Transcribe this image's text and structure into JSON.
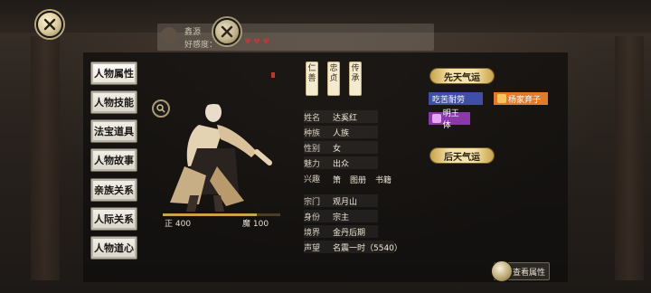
{
  "nav": [
    {
      "label": "人物属性",
      "active": true
    },
    {
      "label": "人物技能",
      "active": false
    },
    {
      "label": "法宝道具",
      "active": false
    },
    {
      "label": "人物故事",
      "active": false
    },
    {
      "label": "亲族关系",
      "active": false
    },
    {
      "label": "人际关系",
      "active": false
    },
    {
      "label": "人物道心",
      "active": false
    }
  ],
  "top_panel": {
    "name": "鑫源",
    "sub": "好感度："
  },
  "character": {
    "alignment_left": "正 400",
    "alignment_right": "魔 100",
    "alignment_fraction": 0.8
  },
  "virtues": [
    "仁善",
    "忠贞",
    "传承"
  ],
  "info": [
    {
      "label": "姓名",
      "value": "达奚红"
    },
    {
      "label": "种族",
      "value": "人族"
    },
    {
      "label": "性别",
      "value": "女"
    },
    {
      "label": "魅力",
      "value": "出众"
    }
  ],
  "hobbies": {
    "label": "兴趣",
    "items": [
      "箫",
      "图册",
      "书籍"
    ]
  },
  "info2": [
    {
      "label": "宗门",
      "value": "观月山"
    },
    {
      "label": "身份",
      "value": "宗主"
    },
    {
      "label": "境界",
      "value": "金丹后期"
    },
    {
      "label": "声望",
      "value": "名震一时（5540）"
    }
  ],
  "fortune": {
    "innate": "先天气运",
    "acquired": "后天气运",
    "traits": [
      {
        "label": "吃苦耐劳",
        "color": "#3f4fa8"
      },
      {
        "label": "杨家弃子",
        "color": "#e07a2c"
      },
      {
        "label": "明王体",
        "color": "#8a3aa8"
      }
    ]
  },
  "view_attributes": "查看属性",
  "colors": {
    "accent": "#c9a24b",
    "scroll": "#f4e2a8"
  }
}
